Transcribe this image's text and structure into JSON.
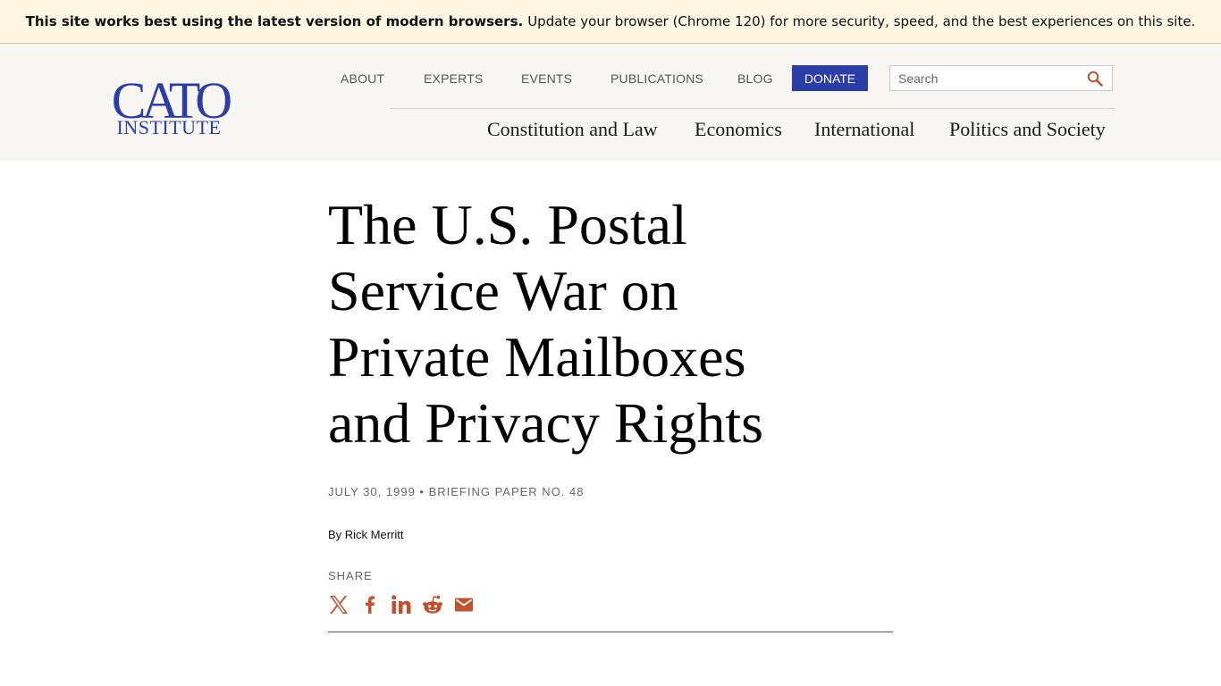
{
  "banner": {
    "bold_text": "This site works best using the latest version of modern browsers.",
    "text": "Update your browser (Chrome 120) for more security, speed, and the best experiences on this site."
  },
  "header": {
    "logo_text": "CATO INSTITUTE",
    "utility_nav": [
      "ABOUT",
      "EXPERTS",
      "EVENTS",
      "PUBLICATIONS",
      "BLOG"
    ],
    "donate_label": "DONATE",
    "search_placeholder": "Search",
    "main_nav": [
      "Constitution and Law",
      "Economics",
      "International",
      "Politics and Society"
    ],
    "brand_color": "#2b3ea8"
  },
  "article": {
    "title": "The U.S. Postal Service War on Private Mailboxes and Privacy Rights",
    "meta": "July 30, 1999 • Briefing Paper No. 48",
    "byline": "By Rick Merritt",
    "share_label": "SHARE",
    "share_icons": [
      "x-icon",
      "facebook-icon",
      "linkedin-icon",
      "reddit-icon",
      "email-icon"
    ],
    "accent_color": "#c0522d"
  }
}
